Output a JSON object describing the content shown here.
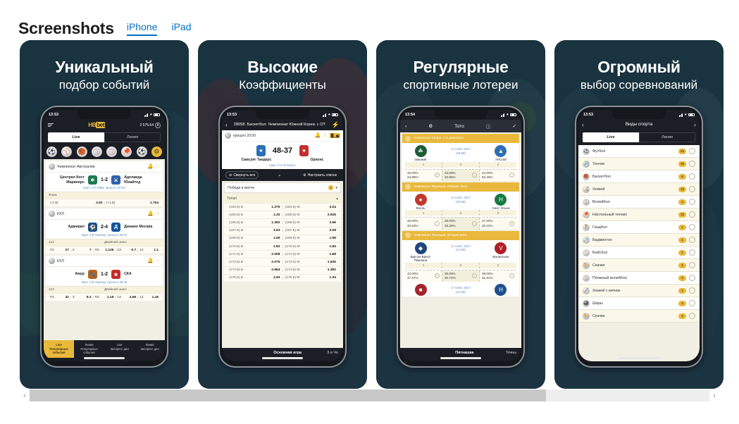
{
  "header": {
    "title": "Screenshots",
    "tabs": [
      {
        "label": "iPhone",
        "active": true
      },
      {
        "label": "iPad",
        "active": false
      }
    ]
  },
  "scrollbar": {
    "left_arrow": "‹",
    "right_arrow": "›"
  },
  "shots": [
    {
      "caption_line1": "Уникальный",
      "caption_line2": "подбор событий",
      "status": {
        "time": "13:53",
        "loc": "➤"
      },
      "appbar": {
        "logo_a": "НВ",
        "logo_b": "bet",
        "balance": "2 575.64",
        "currency": "₽"
      },
      "segments": [
        {
          "label": "Live",
          "on": true
        },
        {
          "label": "Линия",
          "on": false
        }
      ],
      "sport_icons": [
        "⚽",
        "⚾",
        "🏀",
        "🏐",
        "🏐",
        "🏓",
        "⚽",
        "⚙"
      ],
      "events": [
        {
          "league": "Чемпионат Австралии",
          "team_left": "Централ Кост Маринерс",
          "team_right": "Аделаида Юнайтед",
          "score": "1-2",
          "status": "Идет 2-й Тайм, прошло 90:00",
          "market_a": "Фора",
          "market_b": "",
          "odds": [
            {
              "k": "(-1.5)",
              "v": "2.52"
            },
            {
              "k": "(+1.5)",
              "v": "1.704"
            }
          ]
        },
        {
          "league": "КХЛ",
          "team_left": "Адмирал",
          "team_right": "Динамо Москва",
          "score": "2-4",
          "status": "Идет 2-й Период, прошло 36:01",
          "market_a": "1х2",
          "market_b": "Двойной шанс",
          "odds": [
            {
              "k": "П1",
              "v": "27"
            },
            {
              "k": "X",
              "v": "7"
            },
            {
              "k": "П2",
              "v": "1.136"
            },
            {
              "k": "1X",
              "v": "5.7"
            },
            {
              "k": "12",
              "v": "1.1"
            }
          ]
        },
        {
          "league": "КХЛ",
          "team_left": "Амур",
          "team_right": "СКА",
          "score": "1-2",
          "status": "Идет 2-й Период, прошло 38:43",
          "market_a": "1х2",
          "market_b": "Двойной шанс",
          "odds": [
            {
              "k": "П1",
              "v": "32"
            },
            {
              "k": "X",
              "v": "8.3"
            },
            {
              "k": "П2",
              "v": "1.19"
            },
            {
              "k": "1X",
              "v": "4.66"
            },
            {
              "k": "12",
              "v": "1.18"
            }
          ]
        }
      ],
      "tabbar": [
        {
          "l1": "Live",
          "l2": "Популярные события",
          "on": true
        },
        {
          "l1": "Линия",
          "l2": "Популярные события",
          "on": false
        },
        {
          "l1": "Live",
          "l2": "Экспресс дня",
          "on": false
        },
        {
          "l1": "Линия",
          "l2": "Экспресс дня",
          "on": false
        }
      ]
    },
    {
      "caption_line1": "Высокие",
      "caption_line2": "Коэффициенты",
      "status": {
        "time": "13:53",
        "loc": ""
      },
      "title": "28058. Баскетбол. Чемпионат Южной Кореи. с ОТ",
      "event_meta": "прошло 20:00",
      "score": "48-37",
      "team_left": "Самсунг Тандерс",
      "team_right": "Орионс",
      "period": "Идет 3-я Четверть",
      "tools": {
        "collapse": "Свернуть все",
        "settings": "Настроить список"
      },
      "market_title": "Победа в матче",
      "market_badge": "2",
      "totals_title": "Тотал",
      "totals": [
        {
          "lk": "(164.5) Б",
          "lv": "1.275",
          "rk": "(164.5) М",
          "rv": "3.24"
        },
        {
          "lk": "(165.5) Б",
          "lv": "1.33",
          "rk": "(165.5) М",
          "rv": "2.925"
        },
        {
          "lk": "(166.5) Б",
          "lv": "1.392",
          "rk": "(166.5) М",
          "rv": "2.66"
        },
        {
          "lk": "(167.5) Б",
          "lv": "1.63",
          "rk": "(167.5) М",
          "rv": "2.08"
        },
        {
          "lk": "(169.5) Б",
          "lv": "1.69",
          "rk": "(169.5) М",
          "rv": "1.99"
        },
        {
          "lk": "(170.5) Б",
          "lv": "1.82",
          "rk": "(170.5) М",
          "rv": "1.84"
        },
        {
          "lk": "(171.5) Б",
          "lv": "2.008",
          "rk": "(171.5) М",
          "rv": "1.68"
        },
        {
          "lk": "(173.5) Б",
          "lv": "2.075",
          "rk": "(173.5) М",
          "rv": "1.635"
        },
        {
          "lk": "(174.5) Б",
          "lv": "2.664",
          "rk": "(174.5) М",
          "rv": "1.392"
        },
        {
          "lk": "(175.5) Б",
          "lv": "2.93",
          "rk": "(175.5) М",
          "rv": "1.33"
        }
      ],
      "bottom_main": "Основная игра",
      "bottom_side": "3-я Че"
    },
    {
      "caption_line1": "Регулярные",
      "caption_line2": "спортивные лотереи",
      "status": {
        "time": "13:54",
        "loc": ""
      },
      "toto_title": "Тото",
      "matches": [
        {
          "league": "Чемпионат Кипра. 1-й дивизион",
          "date": "17 нояб. 2017",
          "time": "(19:59)",
          "team_left": "Омония",
          "team_right": "АПОЭЛ",
          "labels": [
            "1",
            "X",
            "2"
          ],
          "cells": [
            {
              "p1": "33.00%",
              "p2": "24.88%",
              "sel": true
            },
            {
              "p1": "23.00%",
              "p2": "32.85%",
              "sel": false
            },
            {
              "p1": "44.00%",
              "p2": "52.26%",
              "sel": false
            }
          ]
        },
        {
          "league": "Чемпионат Франции. Первая лига",
          "date": "17 нояб. 2017",
          "time": "(20:59)",
          "team_left": "Лилль",
          "team_right": "Сент-Этьен",
          "labels": [
            "1",
            "X",
            "2"
          ],
          "cells": [
            {
              "p1": "45.00%",
              "p2": "46.53%",
              "sel": false
            },
            {
              "p1": "28.00%",
              "p2": "28.25%",
              "sel": false
            },
            {
              "p1": "27.00%",
              "p2": "25.22%",
              "sel": true
            }
          ]
        },
        {
          "league": "Чемпионат Франции. Вторая лига",
          "date": "17 нояб. 2017",
          "time": "(21:59)",
          "team_left": "Бур-ан-Бресс Перонна",
          "team_right": "Валансьен",
          "labels": [
            "1",
            "X",
            "2"
          ],
          "cells": [
            {
              "p1": "42.00%",
              "p2": "37.37%",
              "sel": true
            },
            {
              "p1": "29.00%",
              "p2": "30.72%",
              "sel": false
            },
            {
              "p1": "29.00%",
              "p2": "31.91%",
              "sel": false
            }
          ]
        },
        {
          "league": "",
          "date": "17 нояб. 2017",
          "time": "(21:59)",
          "team_left": "",
          "team_right": "",
          "labels": [],
          "cells": []
        }
      ],
      "bottom_main": "Пятнашка",
      "bottom_side": "Точны"
    },
    {
      "caption_line1": "Огромный",
      "caption_line2": "выбор соревнований",
      "status": {
        "time": "13:53",
        "loc": ""
      },
      "title": "Виды спорта",
      "segments": [
        {
          "label": "Live",
          "on": true
        },
        {
          "label": "Линия",
          "on": false
        }
      ],
      "sports": [
        {
          "name": "Футбол",
          "count": "23",
          "icon": "⚽"
        },
        {
          "name": "Теннис",
          "count": "10",
          "icon": "🎾"
        },
        {
          "name": "Баскетбол",
          "count": "6",
          "icon": "🏀"
        },
        {
          "name": "Хоккей",
          "count": "13",
          "icon": "🏒"
        },
        {
          "name": "Волейбол",
          "count": "2",
          "icon": "🏐"
        },
        {
          "name": "Настольный теннис",
          "count": "13",
          "icon": "🏓"
        },
        {
          "name": "Гандбол",
          "count": "1",
          "icon": "🤾"
        },
        {
          "name": "Бадминтон",
          "count": "1",
          "icon": "🏸"
        },
        {
          "name": "Бейсбол",
          "count": "1",
          "icon": "⚾"
        },
        {
          "name": "Скачки",
          "count": "2",
          "icon": "🐎"
        },
        {
          "name": "Пляжный волейбол",
          "count": "2",
          "icon": "🏐"
        },
        {
          "name": "Хоккей с мячом",
          "count": "1",
          "icon": "🏑"
        },
        {
          "name": "Шары",
          "count": "2",
          "icon": "🎱"
        },
        {
          "name": "Скачки",
          "count": "2",
          "icon": "🐎"
        }
      ]
    }
  ]
}
